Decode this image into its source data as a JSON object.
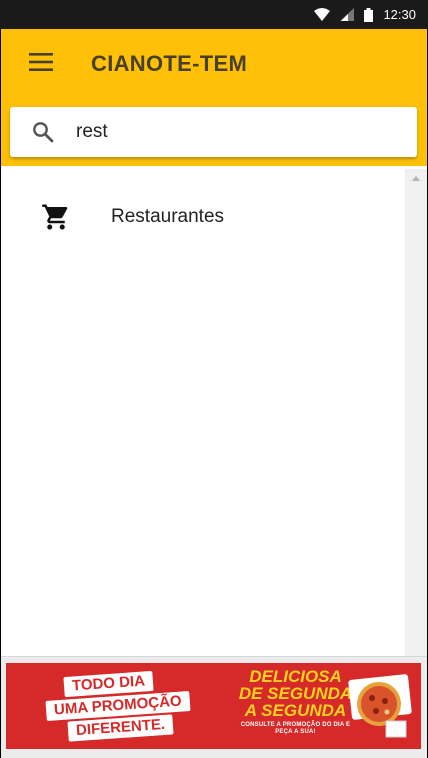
{
  "status_bar": {
    "time": "12:30",
    "icons": [
      "wifi-icon",
      "cell-signal-icon",
      "battery-icon"
    ]
  },
  "app_bar": {
    "title": "CIANOTE-TEM",
    "menu_icon": "hamburger-menu-icon",
    "background_color": "#FFC107"
  },
  "search": {
    "value": "rest",
    "icon": "search-icon"
  },
  "results": [
    {
      "label": "Restaurantes",
      "icon": "shopping-cart-icon"
    }
  ],
  "ad": {
    "left_lines": [
      "TODO DIA",
      "UMA PROMOÇÃO",
      "DIFERENTE."
    ],
    "right_lines": [
      "DELICIOSA",
      "DE SEGUNDA",
      "A SEGUNDA"
    ],
    "small_text": "CONSULTE A PROMOÇÃO DO DIA E PEÇA A SUA!",
    "background_color": "#d62a2a",
    "accent_color": "#FFD21F"
  }
}
